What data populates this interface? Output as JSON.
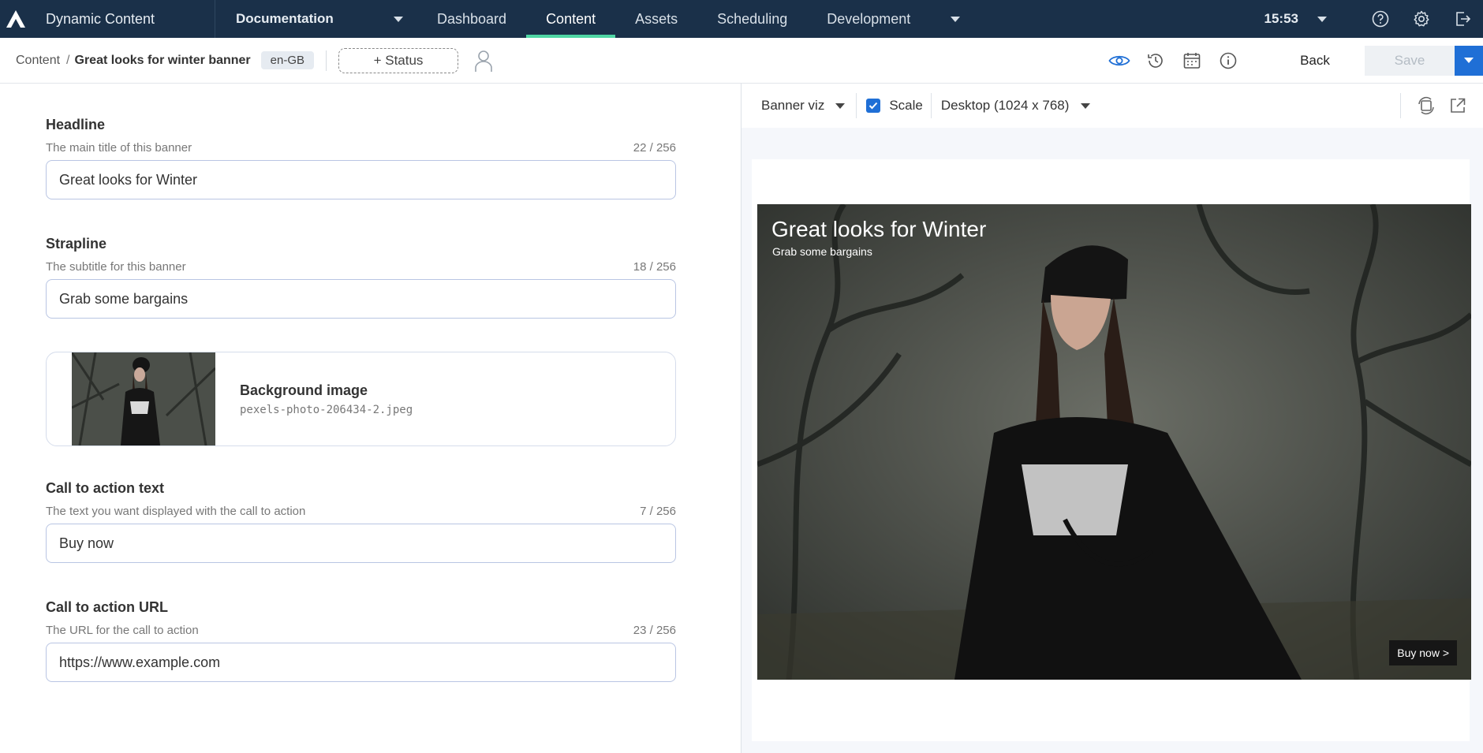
{
  "topnav": {
    "app_name": "Dynamic Content",
    "hub": "Documentation",
    "tabs": [
      {
        "label": "Dashboard"
      },
      {
        "label": "Content"
      },
      {
        "label": "Assets"
      },
      {
        "label": "Scheduling"
      },
      {
        "label": "Development"
      }
    ],
    "active_tab": "Content",
    "time": "15:53"
  },
  "subbar": {
    "breadcrumb_root": "Content",
    "breadcrumb_sep": "/",
    "breadcrumb_current": "Great looks for winter banner",
    "locale": "en-GB",
    "status_button": "+ Status",
    "back_label": "Back",
    "save_label": "Save"
  },
  "form": {
    "headline": {
      "label": "Headline",
      "description": "The main title of this banner",
      "count": "22 / 256",
      "value": "Great looks for Winter"
    },
    "strapline": {
      "label": "Strapline",
      "description": "The subtitle for this banner",
      "count": "18 / 256",
      "value": "Grab some bargains"
    },
    "background_image": {
      "label": "Background image",
      "filename": "pexels-photo-206434-2.jpeg"
    },
    "cta_text": {
      "label": "Call to action text",
      "description": "The text you want displayed with the call to action",
      "count": "7 / 256",
      "value": "Buy now"
    },
    "cta_url": {
      "label": "Call to action URL",
      "description": "The URL for the call to action",
      "count": "23 / 256",
      "value": "https://www.example.com"
    }
  },
  "preview": {
    "visualization": "Banner viz",
    "scale_label": "Scale",
    "scale_checked": true,
    "device": "Desktop (1024 x 768)",
    "banner": {
      "title": "Great looks for Winter",
      "subtitle": "Grab some bargains",
      "cta": "Buy now >"
    }
  },
  "colors": {
    "nav_bg": "#1a3049",
    "active_tab_underline": "#4fd6a4",
    "primary": "#1f6fd6",
    "input_border": "#b9c5e3"
  }
}
